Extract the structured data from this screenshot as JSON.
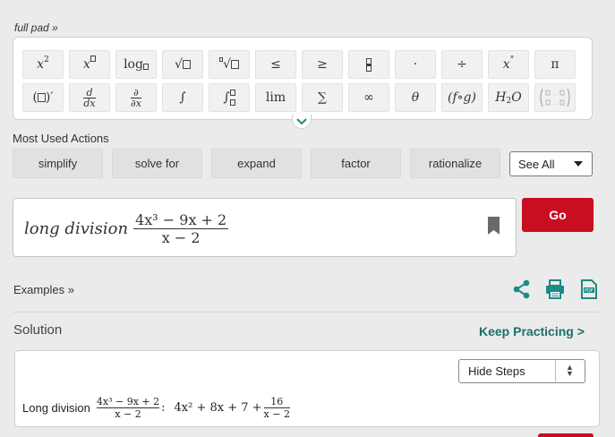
{
  "pad": {
    "toggle_label": "full pad »",
    "row1": [
      "x²",
      "x□",
      "log□",
      "√□",
      "∛□",
      "≤",
      "≥",
      "□/□",
      "·",
      "÷",
      "x°",
      "π"
    ],
    "row2": [
      "(□)′",
      "d/dx",
      "∂/∂x",
      "∫",
      "∫□□",
      "lim",
      "∑",
      "∞",
      "θ",
      "(f∘g)",
      "H₂O",
      "matrix"
    ]
  },
  "most_used": {
    "title": "Most Used Actions",
    "actions": [
      "simplify",
      "solve for",
      "expand",
      "factor",
      "rationalize"
    ],
    "see_all": "See All"
  },
  "input": {
    "prefix": "long division",
    "numerator": "4x³ − 9x + 2",
    "denominator": "x − 2"
  },
  "go_label": "Go",
  "examples_label": "Examples »",
  "solution": {
    "heading": "Solution",
    "keep_practicing": "Keep Practicing >",
    "hide_steps": "Hide Steps",
    "line_label": "Long division",
    "line_num": "4x³ − 9x + 2",
    "line_den": "x − 2",
    "result_prefix": "4x² + 8x + 7 +",
    "result_num": "16",
    "result_den": "x − 2"
  },
  "colors": {
    "go_red": "#c90e22",
    "teal": "#1b6f6f",
    "icon_teal": "#1c8a85"
  },
  "icons": [
    "chevron-down-icon",
    "bookmark-icon",
    "share-icon",
    "print-icon",
    "pdf-icon",
    "caret-down-icon",
    "up-down-icon"
  ]
}
